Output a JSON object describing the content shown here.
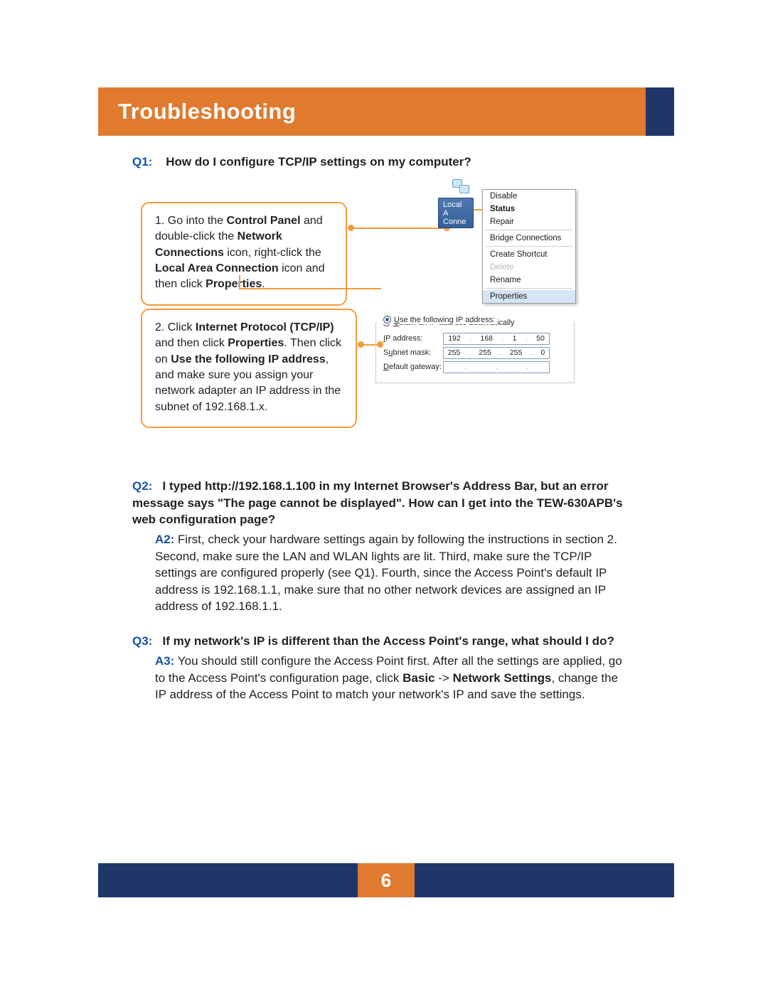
{
  "banner": {
    "title": "Troubleshooting"
  },
  "q1": {
    "label": "Q1:",
    "text": "How do I configure TCP/IP settings on my computer?"
  },
  "step1": {
    "prefix": "1. Go into the ",
    "b1": "Control Panel",
    "mid1": " and double-click the ",
    "b2": "Network Connections",
    "mid2": " icon, right-click the ",
    "b3": "Local Area Connection",
    "mid3": " icon and then click ",
    "b4": "Properties",
    "suffix": "."
  },
  "nc_label": {
    "line1": "Local A",
    "line2": "Conne"
  },
  "ctx": {
    "disable": "Disable",
    "status": "Status",
    "repair": "Repair",
    "bridge": "Bridge Connections",
    "shortcut": "Create Shortcut",
    "delete": "Delete",
    "rename": "Rename",
    "properties": "Properties"
  },
  "step2": {
    "prefix": "2. Click ",
    "b1": "Internet Protocol (TCP/IP)",
    "mid1": " and then click ",
    "b2": "Properties",
    "mid2": ".  Then click on ",
    "b3": "Use the following IP address",
    "mid3": ", and make sure you assign your network adapter an IP address in the subnet of 192.168.1.x."
  },
  "ip": {
    "auto_O": "O",
    "auto_rest": "btain an IP address automatically",
    "use_U": "U",
    "use_rest": "se the following IP address:",
    "ipaddr_I": "I",
    "ipaddr_lbl": "P address:",
    "subnet_S": "S",
    "subnet_u": "u",
    "subnet_rest": "bnet mask:",
    "gw_D": "D",
    "gw_rest": "efault gateway:",
    "ip_o1": "192",
    "ip_o2": "168",
    "ip_o3": "1",
    "ip_o4": "50",
    "sm_o1": "255",
    "sm_o2": "255",
    "sm_o3": "255",
    "sm_o4": "0",
    "gw_o1": "",
    "gw_o2": "",
    "gw_o3": "",
    "gw_o4": ""
  },
  "q2": {
    "label": "Q2:",
    "text": "I typed http://192.168.1.100 in my Internet Browser's Address Bar, but an error message says \"The page cannot be displayed\". How can I get into the TEW-630APB's web configuration page?",
    "a_label": "A2:",
    "a_text": "First, check your hardware settings again by following the instructions in section 2.  Second, make sure the LAN and WLAN lights are lit.  Third, make sure the TCP/IP settings are configured properly (see Q1).   Fourth, since the Access Point's default IP address is 192.168.1.1, make sure that no other network devices are assigned an IP address of 192.168.1.1."
  },
  "q3": {
    "label": "Q3:",
    "text": "If my network's IP is different than the Access Point's range, what should I do?",
    "a_label": "A3:",
    "a_pre": "You should still configure the Access Point first. After all the settings are applied, go to the Access Point's configuration page, click ",
    "a_b1": "Basic",
    "a_mid1": " -> ",
    "a_b2": "Network Settings",
    "a_post": ", change the IP address of the Access Point to match your network's IP and save the settings."
  },
  "footer": {
    "page": "6"
  }
}
